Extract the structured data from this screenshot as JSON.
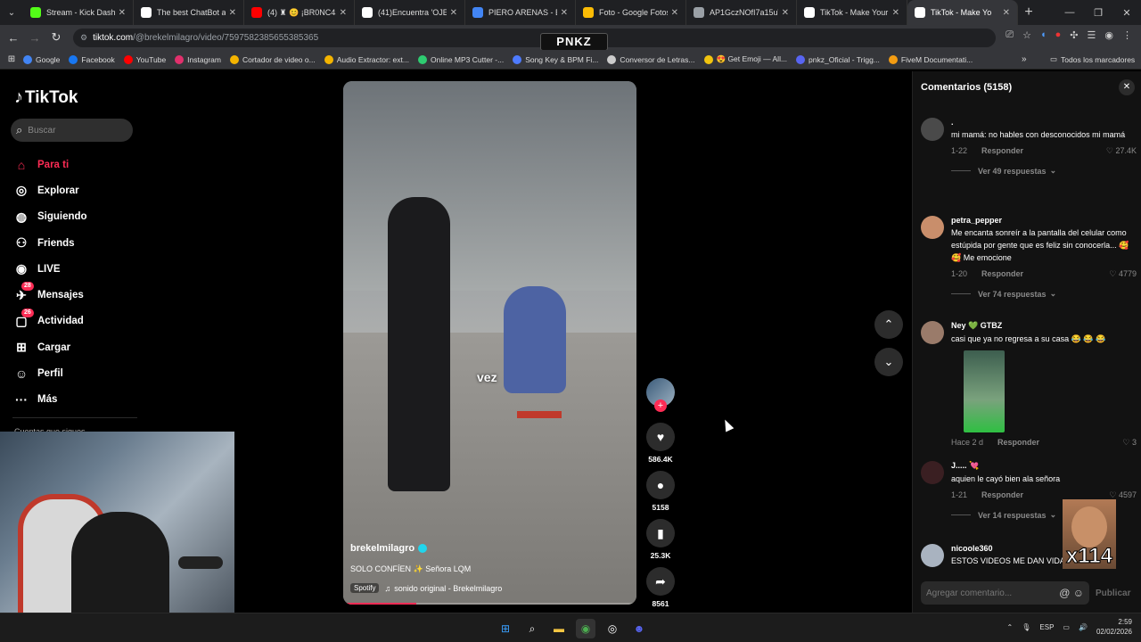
{
  "browser": {
    "tabs": [
      {
        "title": "Stream - Kick Dashbo",
        "icon": "kick-icon",
        "color": "#53fc18"
      },
      {
        "title": "The best ChatBot and",
        "icon": "shield-icon",
        "color": "#ffffff"
      },
      {
        "title": "(4) ♜ 😊 ¡BR0NC4S,",
        "icon": "youtube-icon",
        "color": "#ff0000"
      },
      {
        "title": "(41)Encuentra 'OJERA",
        "icon": "tiktok-icon",
        "color": "#ffffff"
      },
      {
        "title": "PIERO ARENAS - Bus",
        "icon": "google-icon",
        "color": "#4285f4"
      },
      {
        "title": "Foto - Google Fotos",
        "icon": "pinwheel-icon",
        "color": "#fbbc05"
      },
      {
        "title": "AP1GczNOfI7a15uW",
        "icon": "globe-icon",
        "color": "#9aa0a6"
      },
      {
        "title": "TikTok - Make Your D",
        "icon": "tiktok-icon",
        "color": "#ffffff"
      },
      {
        "title": "TikTok - Make Yo",
        "icon": "tiktok-icon",
        "color": "#ffffff",
        "active": true
      }
    ],
    "url_host": "tiktok.com",
    "url_path": "/@brekelmilagro/video/7597582385655385365",
    "overlay_brand": "PNKZ",
    "bookmarks": [
      {
        "label": "Google",
        "color": "#4285f4"
      },
      {
        "label": "Facebook",
        "color": "#1877f2"
      },
      {
        "label": "YouTube",
        "color": "#ff0000"
      },
      {
        "label": "Instagram",
        "color": "#e1306c"
      },
      {
        "label": "Cortador de video o...",
        "color": "#f4b400"
      },
      {
        "label": "Audio Extractor: ext...",
        "color": "#f4b400"
      },
      {
        "label": "Online MP3 Cutter -...",
        "color": "#2ecc71"
      },
      {
        "label": "Song Key & BPM Fi...",
        "color": "#4e7bff"
      },
      {
        "label": "Conversor de Letras...",
        "color": "#cccccc"
      },
      {
        "label": "😍 Get Emoji — All...",
        "color": "#f1c40f"
      },
      {
        "label": "pnkz_Oficial - Trigg...",
        "color": "#5865f2"
      },
      {
        "label": "FiveM Documentati...",
        "color": "#f39c12"
      }
    ],
    "all_bookmarks": "Todos los marcadores"
  },
  "tiktok": {
    "logo": "TikTok",
    "search_placeholder": "Buscar",
    "nav": [
      {
        "label": "Para ti",
        "icon": "home-icon",
        "active": true
      },
      {
        "label": "Explorar",
        "icon": "compass-icon"
      },
      {
        "label": "Siguiendo",
        "icon": "following-avatar-icon"
      },
      {
        "label": "Friends",
        "icon": "friends-icon"
      },
      {
        "label": "LIVE",
        "icon": "live-icon"
      },
      {
        "label": "Mensajes",
        "icon": "messages-icon",
        "badge": "28"
      },
      {
        "label": "Actividad",
        "icon": "activity-icon",
        "badge": "26"
      },
      {
        "label": "Cargar",
        "icon": "upload-icon"
      },
      {
        "label": "Perfil",
        "icon": "profile-icon"
      },
      {
        "label": "Más",
        "icon": "more-icon"
      }
    ],
    "following_heading": "Cuentas que sigues",
    "video": {
      "caption_word": "vez",
      "author": "brekelmilagro",
      "description": "SOLO CONFÍEN ✨ Señora LQM",
      "spotify": "Spotify",
      "sound": "sonido original - Brekelmilagro",
      "progress": 0.25
    },
    "actions": [
      {
        "icon": "heart-icon",
        "count": "586.4K"
      },
      {
        "icon": "comment-icon",
        "count": "5158"
      },
      {
        "icon": "bookmark-icon",
        "count": "25.3K"
      },
      {
        "icon": "share-icon",
        "count": "8561"
      }
    ],
    "comments_panel": {
      "title": "Comentarios",
      "count": "(5158)",
      "comments": [
        {
          "user": ".",
          "text": "mi mamá: no hables con desconocidos mi mamá",
          "date": "1-22",
          "reply": "Responder",
          "likes": "27.4K",
          "replies": "Ver 49 respuestas",
          "avatar": "#4a4a4a"
        },
        {
          "user": "petra_pepper",
          "text": "Me encanta sonreír a la pantalla del celular como estúpida por gente que es feliz sin conocerla... 🥰 🥰 Me emocione",
          "date": "1-20",
          "reply": "Responder",
          "likes": "4779",
          "replies": "Ver 74 respuestas",
          "avatar": "#c98e6b"
        },
        {
          "user": "Ney 💚 GTBZ",
          "text": "casi que ya no regresa a su casa 😂 😂 😂",
          "date": "Hace 2 d",
          "reply": "Responder",
          "likes": "3",
          "replies": "",
          "avatar": "#9a7b6a"
        },
        {
          "user": "J..... 💘",
          "text": "aquien le cayó bien ala señora",
          "date": "1-21",
          "reply": "Responder",
          "likes": "4597",
          "replies": "Ver 14 respuestas",
          "avatar": "#3a1f22"
        },
        {
          "user": "nicoole360",
          "text": "ESTOS VIDEOS ME DAN VIDA 😊 🙏 UN",
          "date": "",
          "reply": "",
          "likes": "",
          "replies": "",
          "avatar": "#a9b3c0"
        }
      ],
      "input_placeholder": "Agregar comentario...",
      "publish": "Publicar"
    },
    "overlay_text": "x114"
  },
  "taskbar": {
    "lang": "ESP",
    "time": "2:59",
    "date": "02/02/2026"
  }
}
